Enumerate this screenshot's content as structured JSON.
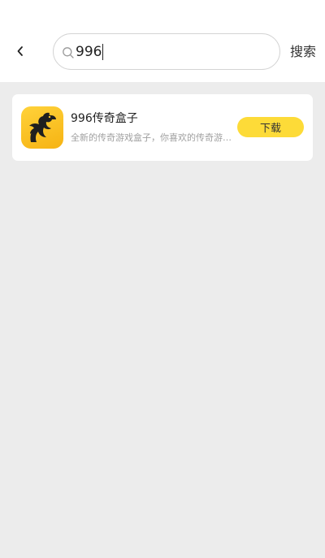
{
  "header": {
    "query": "996",
    "search_label": "搜索"
  },
  "results": [
    {
      "name": "996传奇盒子",
      "description": "全新的传奇游戏盒子，你喜欢的传奇游戏都在这里",
      "download_label": "下载",
      "icon": "dragon-logo-icon",
      "icon_color": "#fbc82a"
    }
  ],
  "colors": {
    "accent": "#fddb38",
    "background": "#ececec"
  }
}
